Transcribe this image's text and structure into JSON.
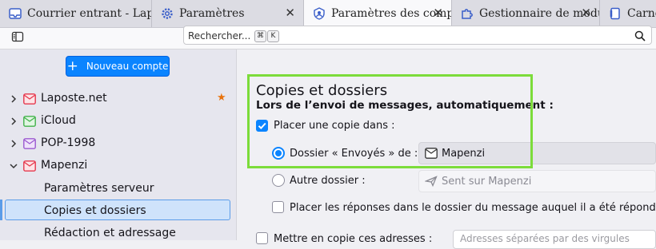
{
  "tabs": [
    {
      "label": "Courrier entrant - Laposte.net",
      "icon": "mail-icon",
      "active": false
    },
    {
      "label": "Paramètres",
      "icon": "gear-icon",
      "active": false
    },
    {
      "label": "Paramètres des comptes",
      "icon": "account-settings-icon",
      "active": true
    },
    {
      "label": "Gestionnaire de modules complémentaires",
      "icon": "puzzle-icon",
      "active": false
    },
    {
      "label": "Carnet d'adresses",
      "icon": "address-book-icon",
      "active": false
    }
  ],
  "toolbar": {
    "search_placeholder": "Rechercher...",
    "shortcut_keys": [
      "⌘",
      "K"
    ]
  },
  "sidebar": {
    "new_account_label": "Nouveau compte",
    "accounts": [
      {
        "label": "Laposte.net",
        "expanded": false,
        "default": true,
        "icon_color": "#e5364b"
      },
      {
        "label": "iCloud",
        "expanded": false,
        "default": false,
        "icon_color": "#41b14a"
      },
      {
        "label": "POP-1998",
        "expanded": false,
        "default": false,
        "icon_color": "#9b59d0"
      },
      {
        "label": "Mapenzi",
        "expanded": true,
        "default": false,
        "icon_color": "#e5364b"
      }
    ],
    "subitems": [
      {
        "label": "Paramètres serveur",
        "selected": false
      },
      {
        "label": "Copies et dossiers",
        "selected": true
      },
      {
        "label": "Rédaction et adressage",
        "selected": false
      }
    ]
  },
  "main": {
    "section_title": "Copies et dossiers",
    "section_subtitle": "Lors de l’envoi de messages, automatiquement :",
    "place_copy_label": "Placer une copie dans :",
    "place_copy_checked": true,
    "sent_folder_label": "Dossier « Envoyés » de :",
    "sent_folder_value": "Mapenzi",
    "other_folder_label": "Autre dossier :",
    "other_folder_value": "Sent sur Mapenzi",
    "replies_label": "Placer les réponses dans le dossier du message auquel il a été répondu",
    "replies_checked": false,
    "cc_label": "Mettre en copie ces adresses :",
    "cc_checked": false,
    "cc_placeholder": "Adresses séparées par des virgules"
  },
  "colors": {
    "accent": "#0a84ff",
    "highlight_box": "#7cdc3a",
    "selected_bg": "#cfe3fb",
    "default_star": "#e8720c"
  }
}
